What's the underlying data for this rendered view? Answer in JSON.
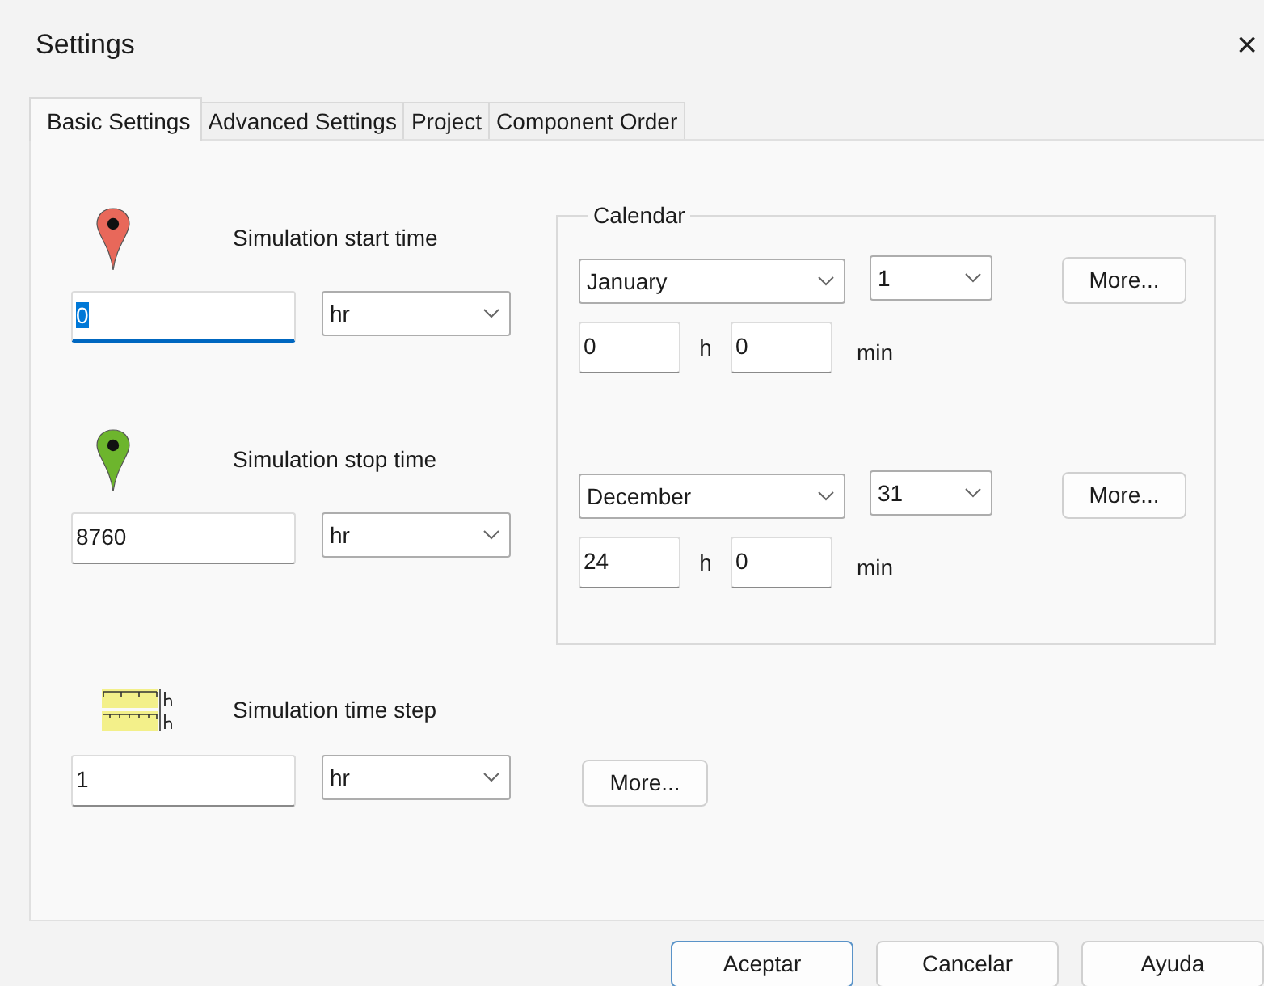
{
  "window": {
    "title": "Settings",
    "close": "×"
  },
  "tabs": [
    {
      "label": "Basic Settings",
      "selected": true
    },
    {
      "label": "Advanced Settings",
      "selected": false
    },
    {
      "label": "Project",
      "selected": false
    },
    {
      "label": "Component Order",
      "selected": false
    }
  ],
  "start": {
    "label": "Simulation start time",
    "value": "0",
    "focused": true,
    "unit": "hr"
  },
  "stop": {
    "label": "Simulation stop time",
    "value": "8760",
    "focused": false,
    "unit": "hr"
  },
  "calendar": {
    "title": "Calendar",
    "rows": [
      {
        "month": "January",
        "day": "1",
        "hours": "0",
        "hours_unit": "h",
        "minutes": "0",
        "minutes_unit": "min",
        "button": "More..."
      },
      {
        "month": "December",
        "day": "31",
        "hours": "24",
        "hours_unit": "h",
        "minutes": "0",
        "minutes_unit": "min",
        "button": "More..."
      }
    ]
  },
  "time_step": {
    "label": "Simulation time step",
    "value": "1",
    "focused": false,
    "unit": "hr",
    "button": "More..."
  },
  "buttons": [
    {
      "label": "Aceptar",
      "default": true
    },
    {
      "label": "Cancelar",
      "default": false
    },
    {
      "label": "Ayuda",
      "default": false
    }
  ]
}
